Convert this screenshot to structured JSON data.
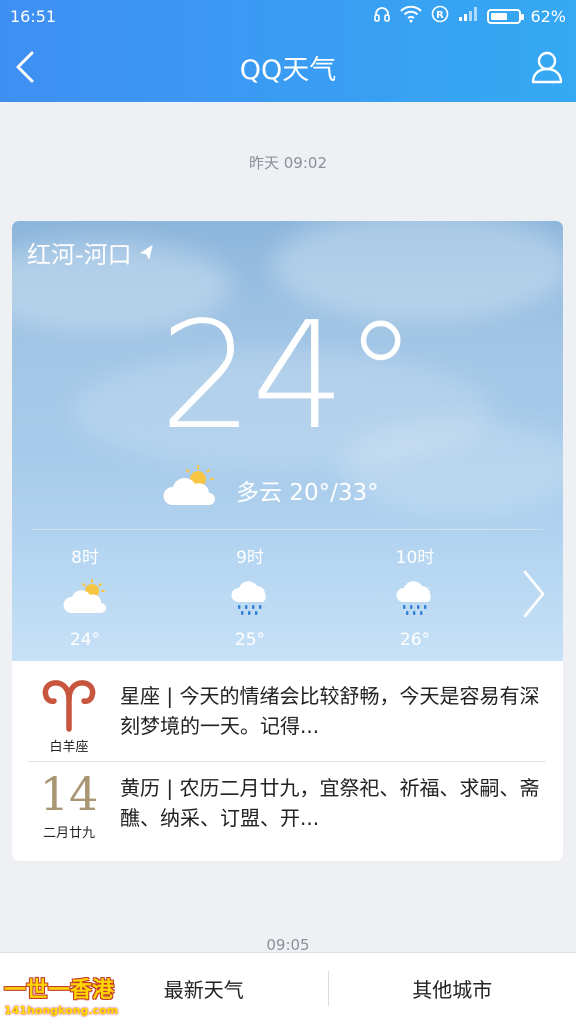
{
  "status_bar": {
    "time": "16:51",
    "battery_percent": "62%",
    "battery_level": 0.62
  },
  "nav": {
    "title": "QQ天气"
  },
  "messages": [
    {
      "timestamp": "昨天 09:02"
    },
    {
      "timestamp": "09:05"
    }
  ],
  "weather": {
    "location": "红河-河口",
    "temperature": "24°",
    "condition_range": "多云 20°/33°",
    "hourly": [
      {
        "time": "8时",
        "icon": "partly-cloudy-icon",
        "temp": "24°"
      },
      {
        "time": "9时",
        "icon": "rain-icon",
        "temp": "25°"
      },
      {
        "time": "10时",
        "icon": "rain-icon",
        "temp": "26°"
      }
    ]
  },
  "horoscope": {
    "sign_label": "白羊座",
    "text": "星座 | 今天的情绪会比较舒畅，今天是容易有深刻梦境的一天。记得..."
  },
  "almanac": {
    "day": "14",
    "lunar_date": "二月廿九",
    "text": "黄历 | 农历二月廿九，宜祭祀、祈福、求嗣、斋醮、纳采、订盟、开..."
  },
  "bottom_tabs": {
    "latest": "最新天气",
    "other": "其他城市"
  },
  "watermark": {
    "main": "一世一香港",
    "sub": "141hongkong.com"
  },
  "colors": {
    "nav": "#3f8ff3",
    "aries": "#c8553d",
    "calendar": "#a99672"
  }
}
